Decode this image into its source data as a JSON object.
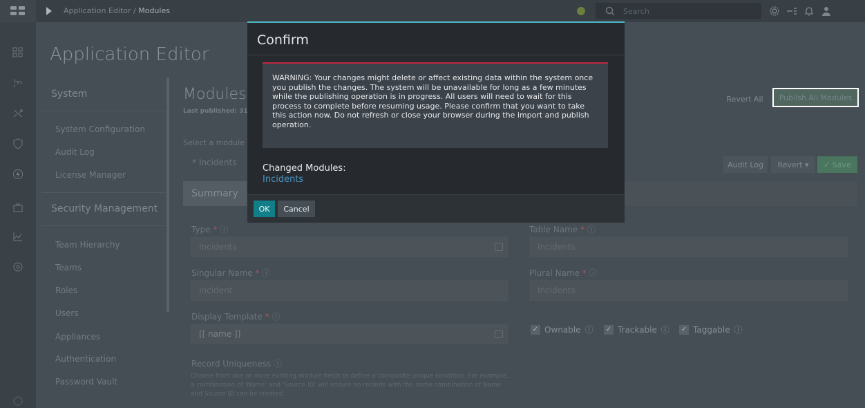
{
  "breadcrumb": {
    "parent": "Application Editor /",
    "current": "Modules"
  },
  "search": {
    "placeholder": "Search"
  },
  "colors": {
    "accent": "#107f89",
    "warning_border": "#c2243f",
    "link": "#4a93c4",
    "modal_top": "#4fb7c6"
  },
  "page": {
    "title": "Application Editor"
  },
  "sidebar": {
    "section_system": "System",
    "system_items": [
      "System Configuration",
      "Audit Log",
      "License Manager"
    ],
    "section_security": "Security Management",
    "security_items": [
      "Team Hierarchy",
      "Teams",
      "Roles",
      "Users",
      "Appliances",
      "Authentication",
      "Password Vault"
    ]
  },
  "modules": {
    "title": "Modules",
    "last_published": "Last published: 31",
    "select_label": "Select a module",
    "selected": "* Incidents",
    "revert_all": "Revert All",
    "publish_all": "Publish All Modules",
    "audit_log": "Audit Log",
    "revert": "Revert ▾",
    "save": "✓ Save",
    "tab_summary": "Summary"
  },
  "form": {
    "type_label": "Type",
    "type_value": "Incidents",
    "table_name_label": "Table Name",
    "table_name_value": "Incidents",
    "singular_label": "Singular Name",
    "singular_value": "Incident",
    "plural_label": "Plural Name",
    "plural_value": "Incidents",
    "display_template_label": "Display Template",
    "display_template_value": "[[ name ]]",
    "ownable": "Ownable",
    "trackable": "Trackable",
    "taggable": "Taggable",
    "uniqueness_label": "Record Uniqueness",
    "uniqueness_desc": "Choose from one or more existing module fields to define a composite unique condition. For example, a combination of 'Name' and 'Source ID' will ensure no records with the same combination of Name and Source ID can be created."
  },
  "modal": {
    "title": "Confirm",
    "warning": "WARNING: Your changes might delete or affect existing data within the system once you publish the changes. The system will be unavailable for long as a few minutes while the publishing operation is in progress. All users will need to wait for this process to complete before resuming usage. Please confirm that you want to take this action now. Do not refresh or close your browser during the import and publish operation.",
    "changed_label": "Changed Modules:",
    "changed_items": [
      "Incidents"
    ],
    "ok": "OK",
    "cancel": "Cancel"
  },
  "icons": {
    "logo": "app-grid-icon",
    "nav_toggle": "play-icon",
    "search": "search-icon",
    "settings": "gear-icon",
    "tasks": "tasks-icon",
    "notifications": "bell-icon",
    "user": "user-icon"
  }
}
